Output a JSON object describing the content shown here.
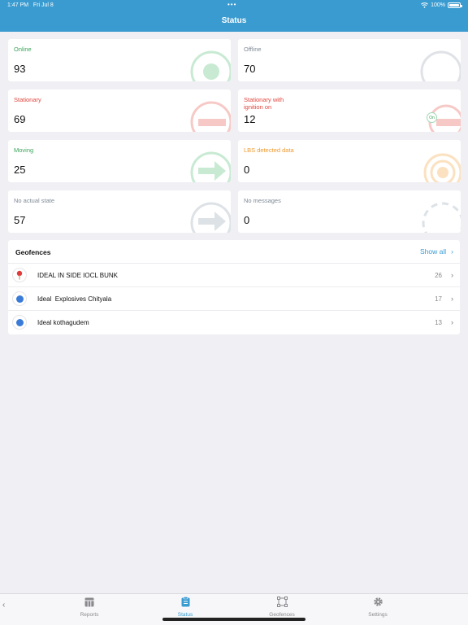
{
  "statusbar": {
    "time": "1:47 PM",
    "date": "Fri Jul 8",
    "battery": "100%",
    "dots": "•••"
  },
  "header": {
    "title": "Status"
  },
  "cards": [
    {
      "label": "Online",
      "value": "93",
      "color": "#3aa55a"
    },
    {
      "label": "Offline",
      "value": "70",
      "color": "#7e8a96"
    },
    {
      "label": "Stationary",
      "value": "69",
      "color": "#e0463e"
    },
    {
      "label": "Stationary with ignition on",
      "value": "12",
      "color": "#e0463e",
      "badge": "On"
    },
    {
      "label": "Moving",
      "value": "25",
      "color": "#3aa55a"
    },
    {
      "label": "LBS detected data",
      "value": "0",
      "color": "#f09a2e"
    },
    {
      "label": "No actual state",
      "value": "57",
      "color": "#7e8a96"
    },
    {
      "label": "No messages",
      "value": "0",
      "color": "#7e8a96"
    }
  ],
  "geofences": {
    "title": "Geofences",
    "show_all": "Show all",
    "items": [
      {
        "name": "IDEAL IN SIDE IOCL BUNK",
        "count": "26",
        "icon": "pin-icon"
      },
      {
        "name": "Ideal  Explosives Chityala",
        "count": "17",
        "icon": "circle-icon"
      },
      {
        "name": "Ideal kothagudem",
        "count": "13",
        "icon": "circle-icon"
      }
    ]
  },
  "tabs": [
    {
      "label": "Reports",
      "icon": "reports-icon"
    },
    {
      "label": "Status",
      "icon": "clipboard-icon",
      "active": true
    },
    {
      "label": "Geofences",
      "icon": "geofence-icon"
    },
    {
      "label": "Settings",
      "icon": "gear-icon"
    }
  ]
}
